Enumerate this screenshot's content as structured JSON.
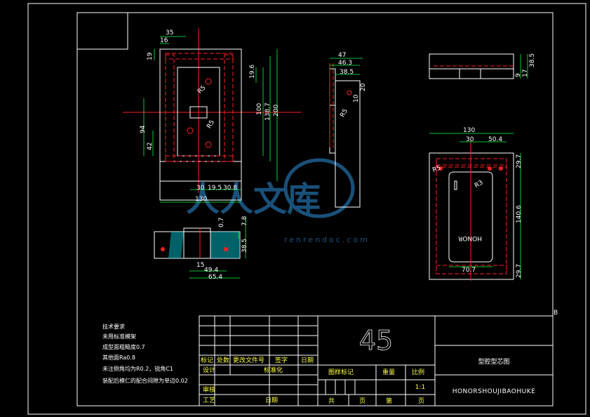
{
  "colors": {
    "background": "#000000",
    "outline": "#ffffff",
    "centerline": "#ff2020",
    "dimension": "#00ff40",
    "watermark": "#1e5f8f"
  },
  "watermark": {
    "text": "人人文库",
    "url": "renrendoc.com"
  },
  "sheet_marker": "B",
  "dims": {
    "top_view": [
      "35",
      "16",
      "19",
      "19.6",
      "R5",
      "100",
      "138.7",
      "200",
      "R5",
      "94",
      "42",
      "30",
      "19.5",
      "30.8",
      "130"
    ],
    "side_view": [
      "47",
      "46.3",
      "38.5",
      "20",
      "10",
      "R5"
    ],
    "small_view": [
      "9",
      "17",
      "38.5"
    ],
    "right_view": [
      "130",
      "30",
      "50.4",
      "29.7",
      "R5",
      "R3",
      "140.6",
      "29.7",
      "70.7",
      "HONOR"
    ],
    "section_view": [
      "0.7",
      "7.8",
      "38.5",
      "15",
      "49.4",
      "65.4"
    ]
  },
  "tech_notes": {
    "title": "技术要求",
    "lines": [
      "未用标准模架",
      "成型面粗糙度0.7",
      "其他面Ra0.8",
      "未注倒角均为R0.2，锐角C1",
      "装配后模仁的配合间隙为单边0.02"
    ]
  },
  "title_block": {
    "material": "45",
    "drawing_name": "型腔型芯图",
    "drawing_code": "HONORSHOUJIBAOHUKE",
    "scale": "1:1",
    "labels": {
      "mark": "标记",
      "count": "处数",
      "change_doc": "更改文件号",
      "sign": "签字",
      "date": "日期",
      "design": "设计",
      "standard": "标准化",
      "review": "审核",
      "process": "工艺",
      "date2": "日期",
      "stage_mark": "图样标记",
      "weight": "重量",
      "ratio": "比例",
      "total": "共",
      "page": "页",
      "sheet_no": "第",
      "page2": "页"
    }
  }
}
